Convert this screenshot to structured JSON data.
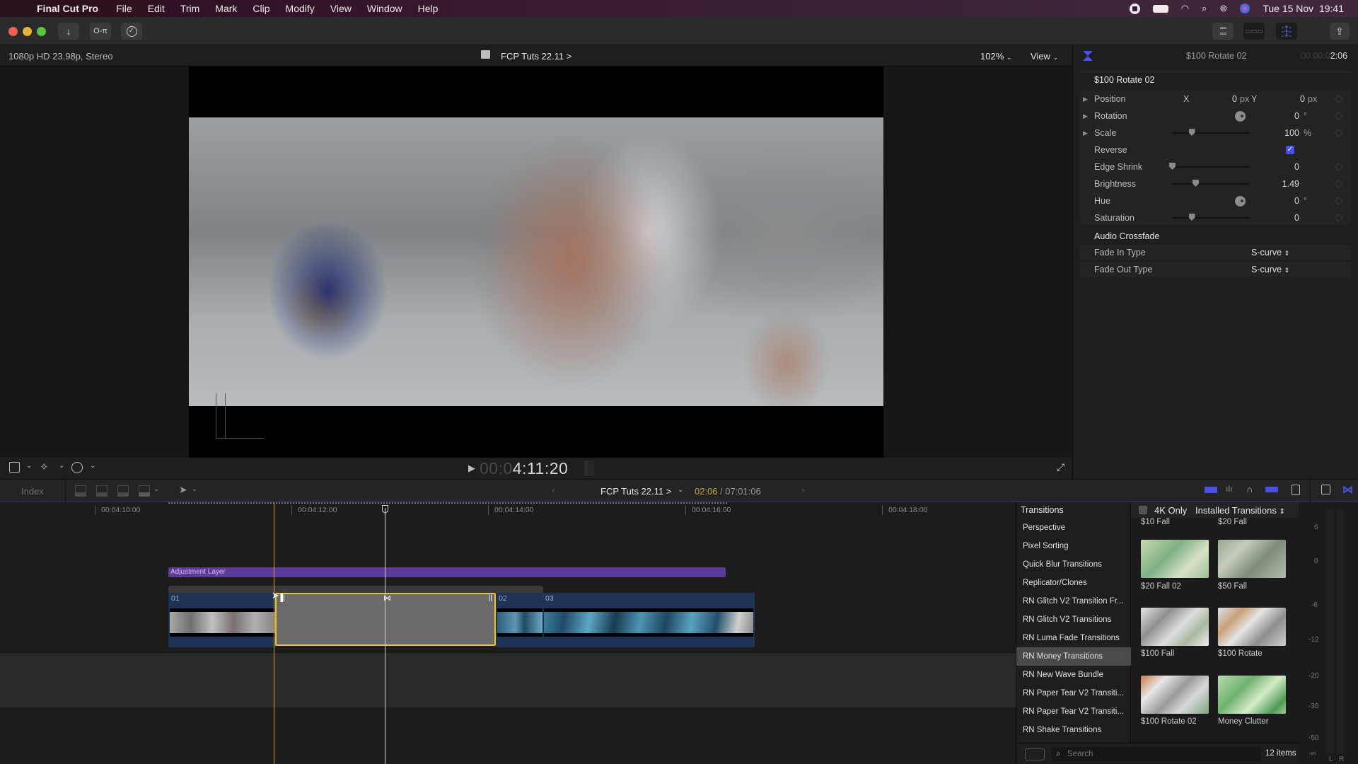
{
  "menubar": {
    "app_name": "Final Cut Pro",
    "items": [
      "File",
      "Edit",
      "Trim",
      "Mark",
      "Clip",
      "Modify",
      "View",
      "Window",
      "Help"
    ],
    "date_time": "Tue 15 Nov  19:41",
    "status_icons": [
      "screen-record-icon",
      "battery-icon",
      "wifi-icon",
      "spotlight-icon",
      "control-center-icon",
      "siri-icon"
    ]
  },
  "toolbar": {
    "import_icon": "↓",
    "keywords_icon": "O‑π",
    "background_tasks_icon": "✓",
    "share_icon": "⇪"
  },
  "viewer": {
    "format": "1080p HD 23.98p, Stereo",
    "project": "FCP Tuts 22.11 >",
    "zoom": "102%",
    "view_menu": "View",
    "timecode_dim": "00:0",
    "timecode_bright": "4:11:20"
  },
  "inspector": {
    "header_title": "$100 Rotate 02",
    "header_duration_dim": "00:00:0",
    "header_duration": "2:06",
    "section_title": "$100 Rotate 02",
    "params": {
      "position": {
        "label": "Position",
        "x_label": "X",
        "x": "0",
        "x_unit": "px",
        "y_label": "Y",
        "y": "0",
        "y_unit": "px"
      },
      "rotation": {
        "label": "Rotation",
        "value": "0",
        "unit": "°"
      },
      "scale": {
        "label": "Scale",
        "value": "100",
        "unit": "%",
        "slider": 0.25
      },
      "reverse": {
        "label": "Reverse",
        "checked": true
      },
      "edge_shrink": {
        "label": "Edge Shrink",
        "value": "0",
        "slider": 0.0
      },
      "brightness": {
        "label": "Brightness",
        "value": "1.49",
        "slider": 0.3
      },
      "hue": {
        "label": "Hue",
        "value": "0",
        "unit": "°"
      },
      "saturation": {
        "label": "Saturation",
        "value": "0",
        "slider": 0.25
      }
    },
    "audio_section": "Audio Crossfade",
    "fade_in": {
      "label": "Fade In Type",
      "value": "S-curve"
    },
    "fade_out": {
      "label": "Fade Out Type",
      "value": "S-curve"
    }
  },
  "timeline_toolbar": {
    "index": "Index",
    "project": "FCP Tuts 22.11 >",
    "position": "02:06",
    "duration": "/ 07:01:06"
  },
  "timeline": {
    "ruler": [
      "00:04:10:00",
      "00:04:12:00",
      "00:04:14:00",
      "00:04:16:00",
      "00:04:18:00"
    ],
    "adjustment_layer": "Adjustment Layer",
    "clips": [
      "01",
      "02",
      "03"
    ]
  },
  "browser": {
    "title": "Transitions",
    "four_k_only": "4K Only",
    "source": "Installed Transitions",
    "categories": [
      "Perspective",
      "Pixel Sorting",
      "Quick Blur Transitions",
      "Replicator/Clones",
      "RN Glitch V2 Transition Fr...",
      "RN Glitch V2 Transitions",
      "RN Luma Fade Transitions",
      "RN Money Transitions",
      "RN New Wave Bundle",
      "RN Paper Tear V2 Transiti...",
      "RN Paper Tear V2 Transiti...",
      "RN Shake Transitions"
    ],
    "selected_category": "RN Money Transitions",
    "items": [
      "$10 Fall",
      "$20 Fall",
      "$20 Fall 02",
      "$50 Fall",
      "$100 Fall",
      "$100 Rotate",
      "$100 Rotate 02",
      "Money Clutter"
    ],
    "search_placeholder": "Search",
    "count": "12 items"
  },
  "meters": {
    "scale": [
      "6",
      "0",
      "-6",
      "-12",
      "-20",
      "-30",
      "-50",
      "-∞"
    ],
    "channels": [
      "L",
      "R"
    ]
  },
  "colors": {
    "accent": "#5b4ef0",
    "adjustment_layer": "#5b3a9a",
    "selection": "#f1c40f",
    "clip": "#1f3357"
  }
}
